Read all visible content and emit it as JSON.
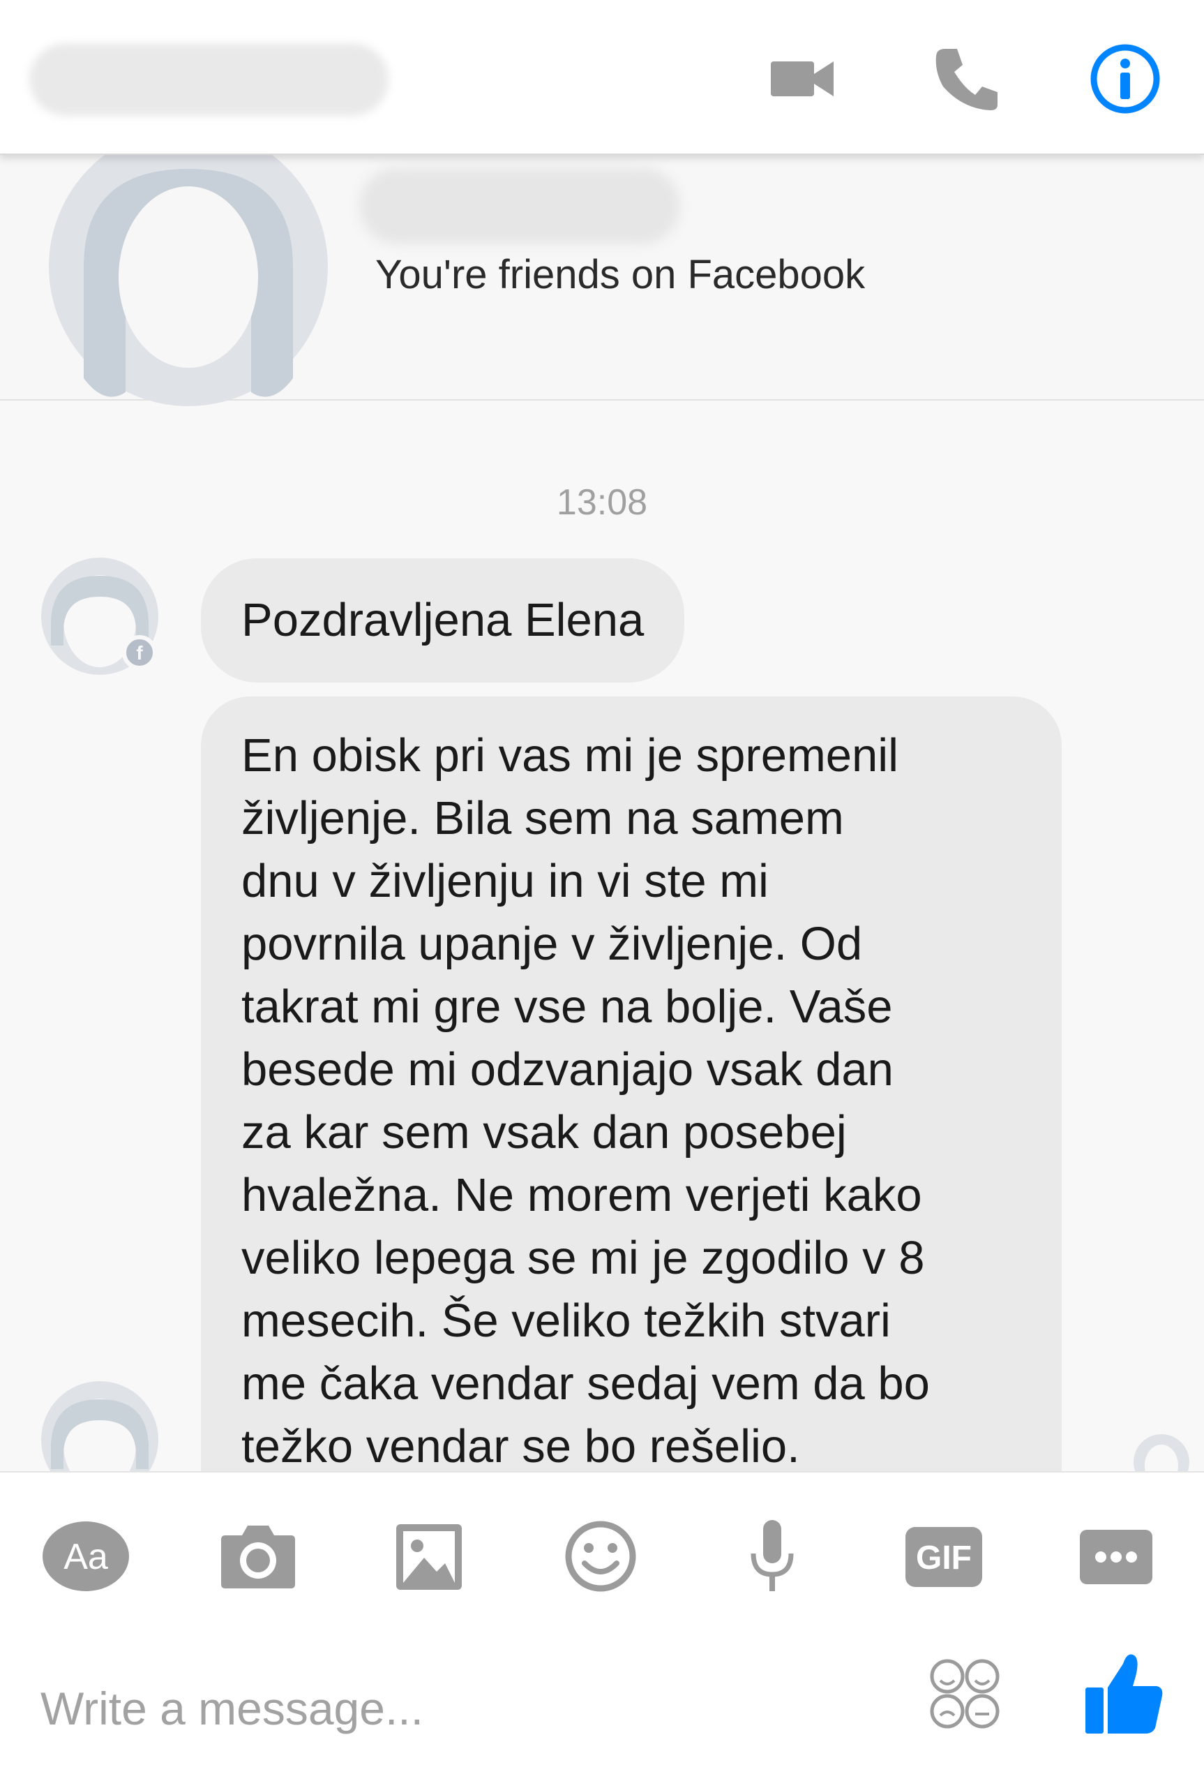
{
  "header": {
    "contact_name": "",
    "icons": [
      "video-camera-icon",
      "phone-icon",
      "info-icon"
    ],
    "accent_color": "#0084ff",
    "icon_color": "#9b9b9b"
  },
  "profile": {
    "friends_text": "You're friends on Facebook"
  },
  "conversation": {
    "timestamp": "13:08",
    "messages": [
      {
        "lines": [
          "Pozdravljena Elena"
        ]
      },
      {
        "lines": [
          "En obisk pri vas mi je spremenil",
          "življenje. Bila sem na samem",
          "dnu v življenju in vi ste mi",
          "povrnila upanje v življenje. Od",
          "takrat mi gre vse na bolje. Vaše",
          "besede mi odzvanjajo vsak dan",
          "za kar sem vsak dan posebej",
          "hvaležna. Ne morem verjeti kako",
          "veliko lepega se mi je zgodilo v 8",
          "mesecih. Še veliko težkih stvari",
          "me čaka vendar sedaj vem da bo",
          "težko vendar se bo rešelio."
        ]
      }
    ],
    "bubble_color": "#eaeaea"
  },
  "composer": {
    "tools": [
      "text-format-icon",
      "camera-icon",
      "image-icon",
      "emoji-icon",
      "microphone-icon",
      "gif-icon",
      "more-icon"
    ],
    "text_format_label": "Aa",
    "gif_label": "GIF",
    "placeholder": "Write a message...",
    "like_color": "#0084ff"
  }
}
